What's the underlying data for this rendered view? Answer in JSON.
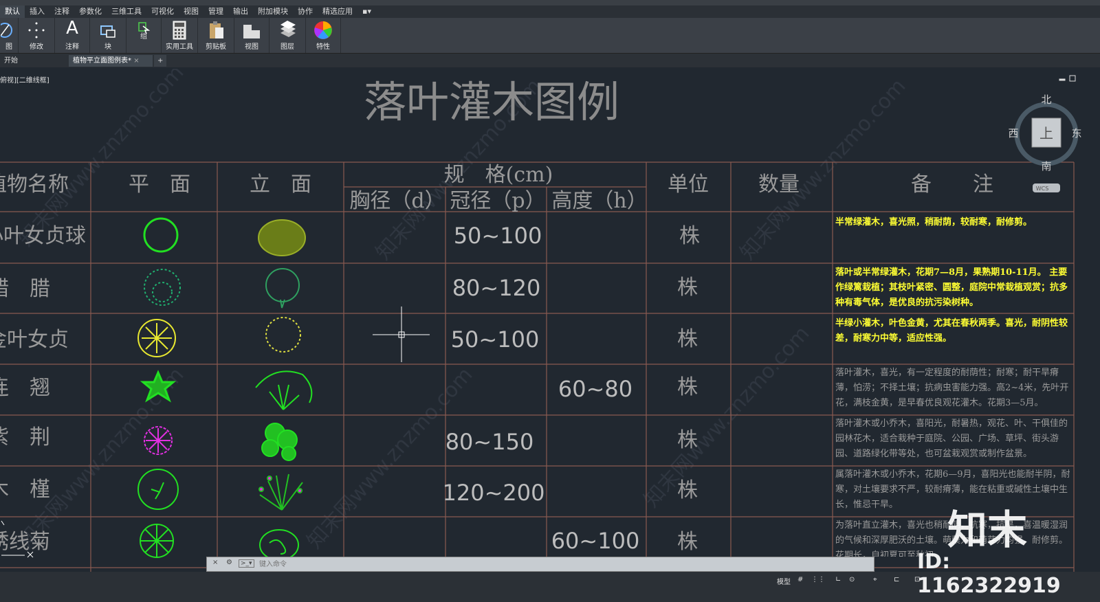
{
  "menubar": {
    "tabs": [
      "默认",
      "插入",
      "注释",
      "参数化",
      "三维工具",
      "可视化",
      "视图",
      "管理",
      "输出",
      "附加模块",
      "协作",
      "精选应用"
    ]
  },
  "ribbon": {
    "buttons": [
      "绘图",
      "修改",
      "注释",
      "块",
      "组",
      "实用工具",
      "剪贴板",
      "视图",
      "图层",
      "特性"
    ],
    "draw_label": "图",
    "annotate_letter": "A"
  },
  "filetabs": {
    "tabs": [
      "开始",
      "植物平立面图例表*"
    ],
    "close_glyph": "×",
    "plus_glyph": "+"
  },
  "viewport": {
    "label": "俯视][二维线框]"
  },
  "drawing": {
    "title": "落叶灌木图例",
    "headers": {
      "name": "植物名称",
      "plan": "平　面",
      "elevation": "立　面",
      "spec": "规　格(cm)",
      "dbh": "胸径（d）",
      "crown": "冠径（p）",
      "height": "高度（h）",
      "unit": "单位",
      "qty": "数量",
      "remark": "备　　注"
    },
    "rows": [
      {
        "name": "小叶女贞球",
        "dbh": "",
        "crown": "50~100",
        "height": "",
        "unit": "株",
        "remark": "半常绿灌木，喜光照，稍耐荫，较耐寒，耐修剪。"
      },
      {
        "name": "蜡　腊",
        "dbh": "",
        "crown": "80~120",
        "height": "",
        "unit": "株",
        "remark": "落叶或半常绿灌木，花期7—8月，果熟期10-11月。 主要作绿篱栽植；其枝叶紧密、圆整，庭院中常栽植观赏；抗多种有毒气体，是优良的抗污染树种。"
      },
      {
        "name": "金叶女贞",
        "dbh": "",
        "crown": "50~100",
        "height": "",
        "unit": "株",
        "remark": "半绿小灌木，叶色金黄，尤其在春秋两季。喜光，耐阴性较差，耐寒力中等，适应性强。"
      },
      {
        "name": "连　翘",
        "dbh": "",
        "crown": "",
        "height": "60~80",
        "unit": "株",
        "remark": "落叶灌木，喜光，有一定程度的耐荫性；耐寒；耐干旱瘠薄，怕涝；不择土壤；抗病虫害能力强。高2~4米，先叶开花，满枝金黄，是早春优良观花灌木。花期3—5月。"
      },
      {
        "name": "紫　荆",
        "dbh": "",
        "crown": "80~150",
        "height": "",
        "unit": "株",
        "remark": "落叶灌木或小乔木，喜阳光，耐暑热，观花、叶、干俱佳的园林花木，适合栽种于庭院、公园、广场、草坪、街头游园、道路绿化带等处，也可盆栽观赏或制作盆景。"
      },
      {
        "name": "木　槿",
        "dbh": "",
        "crown": "120~200",
        "height": "",
        "unit": "株",
        "remark": "属落叶灌木或小乔木，花期6—9月，喜阳光也能耐半阴，耐寒，对土壤要求不严，较耐瘠薄，能在粘重或碱性土壤中生长，惟忌干旱。"
      },
      {
        "name": "绣线菊",
        "dbh": "",
        "crown": "",
        "height": "60~100",
        "unit": "株",
        "remark": "为落叶直立灌木，喜光也稍耐阴，抗寒，抗旱，喜温暖湿润的气候和深厚肥沃的土壤。萌蘖力和萌芽力均强，耐修剪。花期长，自初夏可至秋初。"
      }
    ]
  },
  "viewcube": {
    "north": "北",
    "south": "南",
    "west": "西",
    "east": "东",
    "top": "上",
    "wcs": "WCS"
  },
  "commandline": {
    "placeholder": "键入命令"
  },
  "statusbar": {
    "model": "模型"
  },
  "overlay": {
    "brand": "知末",
    "id_text": "ID: 1162322919",
    "watermark_text": "知末网www.znzmo.com"
  },
  "colors": {
    "canvas": "#212830",
    "grid_line": "#8a5a50",
    "text_gray": "#9a9a9a",
    "remark_yellow": "#ffff33",
    "symbol_green": "#22e022",
    "symbol_yellow": "#e8e830",
    "symbol_magenta": "#e030e0"
  }
}
